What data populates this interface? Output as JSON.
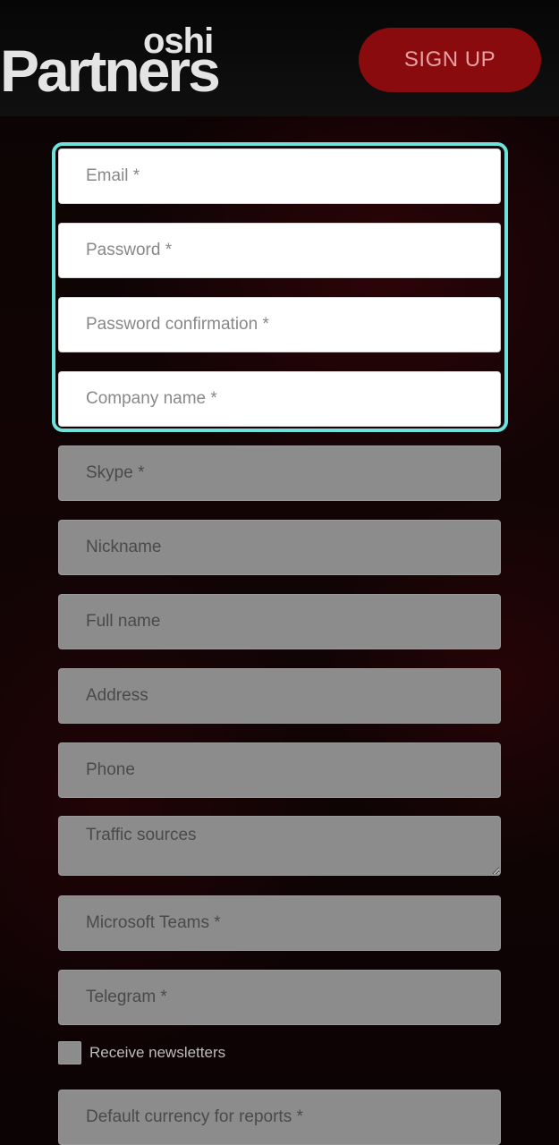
{
  "header": {
    "logo_top": "oshi",
    "logo_main": "Partners",
    "signup_label": "SIGN UP"
  },
  "form": {
    "email": {
      "placeholder": "Email *"
    },
    "password": {
      "placeholder": "Password *"
    },
    "password_confirmation": {
      "placeholder": "Password confirmation *"
    },
    "company_name": {
      "placeholder": "Company name *"
    },
    "skype": {
      "placeholder": "Skype *"
    },
    "nickname": {
      "placeholder": "Nickname"
    },
    "full_name": {
      "placeholder": "Full name"
    },
    "address": {
      "placeholder": "Address"
    },
    "phone": {
      "placeholder": "Phone"
    },
    "traffic_sources": {
      "placeholder": "Traffic sources"
    },
    "microsoft_teams": {
      "placeholder": "Microsoft Teams *"
    },
    "telegram": {
      "placeholder": "Telegram *"
    },
    "newsletter_label": "Receive newsletters",
    "default_currency": {
      "placeholder": "Default currency for reports *"
    }
  },
  "colors": {
    "accent_highlight": "#6ee3de",
    "signup_button": "#8a0b0d"
  }
}
